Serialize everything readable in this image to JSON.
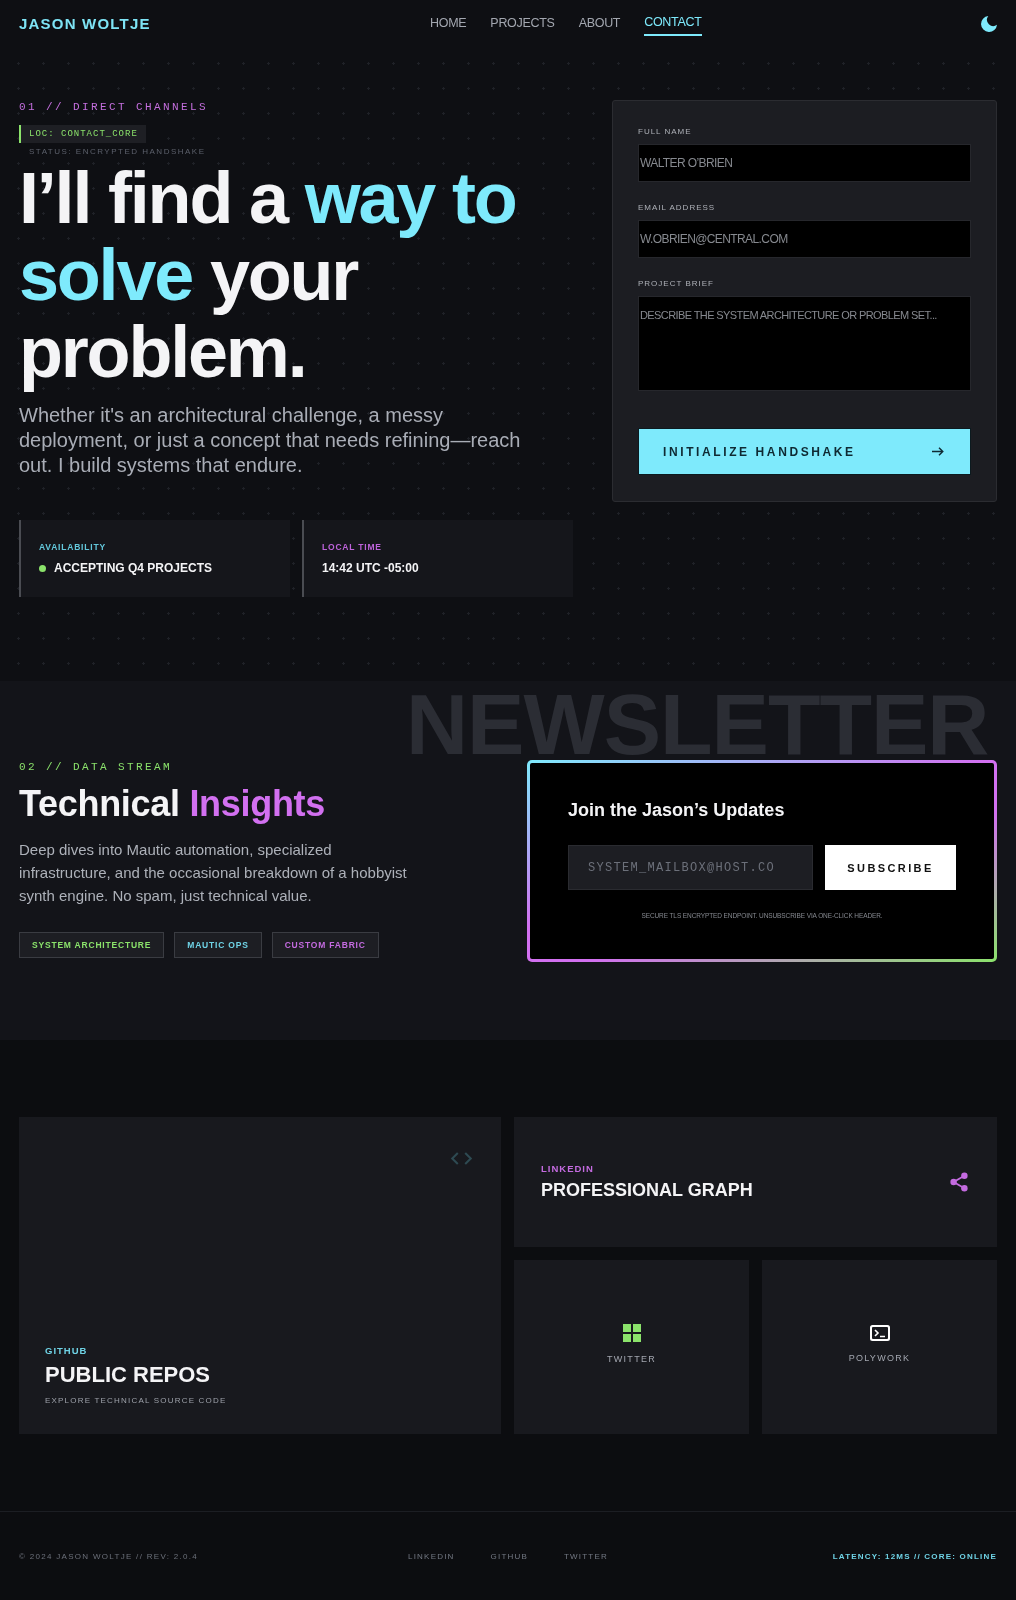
{
  "header": {
    "logo": "JASON WOLTJE",
    "nav": [
      {
        "label": "HOME",
        "selected": false
      },
      {
        "label": "PROJECTS",
        "selected": false
      },
      {
        "label": "ABOUT",
        "selected": false
      },
      {
        "label": "CONTACT",
        "selected": true
      }
    ]
  },
  "hero": {
    "eyebrow": "01 // DIRECT CHANNELS",
    "location_tag": "LOC: CONTACT_CORE",
    "status": "STATUS: ENCRYPTED HANDSHAKE",
    "headline": [
      {
        "text": "I’ll find a ",
        "highlight": false
      },
      {
        "text": "way to solve",
        "highlight": true
      },
      {
        "text": " your problem.",
        "highlight": false
      }
    ],
    "intro": "Whether it's an architectural challenge, a messy deployment, or just a concept that needs refining—reach out. I build systems that endure.",
    "stats": [
      {
        "kind": "status",
        "label": "AVAILABILITY",
        "value": "ACCEPTING Q4 PROJECTS",
        "color": "#63c8dc"
      },
      {
        "kind": "time",
        "label": "LOCAL TIME",
        "value": "14:42 UTC -05:00",
        "color": "#bd63da"
      }
    ]
  },
  "contact_form": {
    "fields": [
      {
        "kind": "input",
        "label": "FULL NAME",
        "placeholder": "WALTER O’BRIEN"
      },
      {
        "kind": "input",
        "label": "EMAIL ADDRESS",
        "placeholder": "W.OBRIEN@CENTRAL.COM"
      },
      {
        "kind": "textarea",
        "label": "PROJECT BRIEF",
        "placeholder": "DESCRIBE THE SYSTEM ARCHITECTURE OR PROBLEM SET..."
      }
    ],
    "submit": "INITIALIZE HANDSHAKE"
  },
  "newsletter": {
    "eyebrow": "02 // DATA STREAM",
    "title": [
      {
        "text": "Technical ",
        "highlight": false
      },
      {
        "text": "Insights",
        "highlight": true
      }
    ],
    "body": "Deep dives into Mautic automation, specialized infrastructure, and the occasional breakdown of a hobbyist synth engine. No spam, just technical value.",
    "tags": [
      {
        "label": "SYSTEM ARCHITECTURE",
        "color": "#8be36b"
      },
      {
        "label": "MAUTIC OPS",
        "color": "#6fd3e6"
      },
      {
        "label": "CUSTOM FABRIC",
        "color": "#c46be0"
      }
    ],
    "backdrop_text": "NEWSLETTER",
    "signup": {
      "title": "Join the Jason’s Updates",
      "email_placeholder": "SYSTEM_MAILBOX@HOST.CO",
      "button": "SUBSCRIBE",
      "note": "SECURE TLS ENCRYPTED ENDPOINT. UNSUBSCRIBE VIA ONE-CLICK HEADER."
    }
  },
  "links": [
    {
      "kind": "feature",
      "platform": "GITHUB",
      "title": "PUBLIC REPOS",
      "subtitle": "EXPLORE TECHNICAL SOURCE CODE",
      "color": "#6fd3e6"
    },
    {
      "kind": "wide",
      "platform": "LINKEDIN",
      "title": "PROFESSIONAL GRAPH",
      "color": "#c46be0"
    },
    {
      "kind": "tile",
      "label": "TWITTER",
      "color": "#8be36b"
    },
    {
      "kind": "tile",
      "label": "POLYWORK",
      "color": "#ffffff"
    }
  ],
  "footer": {
    "copyright": "© 2024 JASON WOLTJE // REV: 2.0.4",
    "links": [
      "LINKEDIN",
      "GITHUB",
      "TWITTER"
    ],
    "status": "LATENCY: 12MS // CORE: ONLINE"
  }
}
